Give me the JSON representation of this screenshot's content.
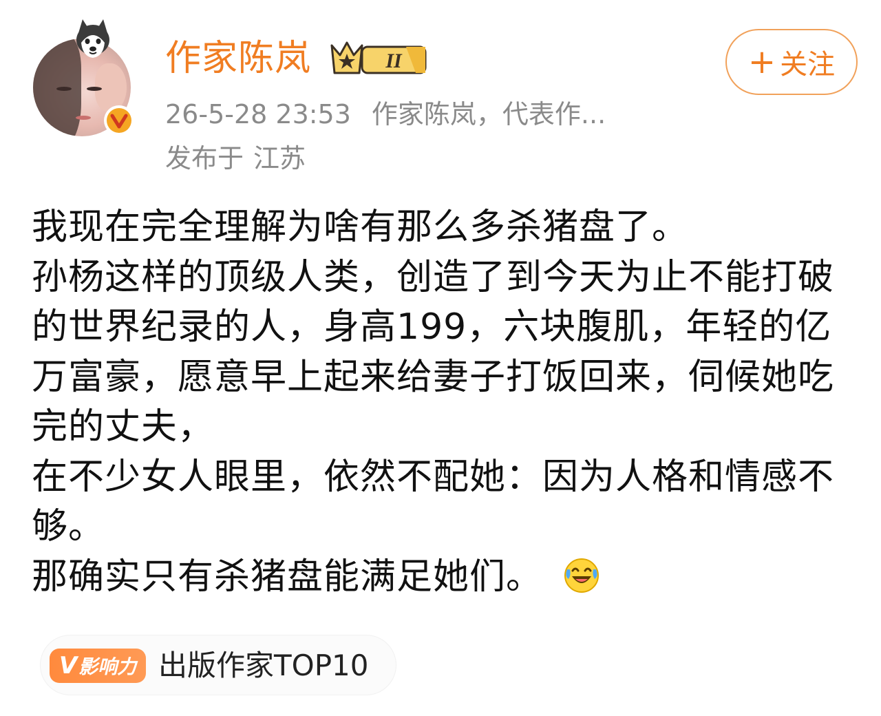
{
  "post": {
    "author": {
      "name": "作家陈岚",
      "level_badge": "II"
    },
    "follow_label": "关注",
    "follow_plus": "+",
    "timestamp": "26-5-28 23:53",
    "author_bio": "作家陈岚，代表作...",
    "location_prefix": "发布于",
    "location": "江苏",
    "paragraphs": [
      "我现在完全理解为啥有那么多杀猪盘了。",
      "孙杨这样的顶级人类，创造了到今天为止不能打破的世界纪录的人，身高199，六块腹肌，年轻的亿万富豪，愿意早上起来给妻子打饭回来，伺候她吃完的丈夫，",
      "在不少女人眼里，依然不配她：因为人格和情感不够。",
      "那确实只有杀猪盘能满足她们。"
    ],
    "influence": {
      "badge_v": "V",
      "badge_label": "影响力",
      "text": "出版作家TOP10"
    }
  },
  "colors": {
    "accent": "#f07d22",
    "meta_text": "#8a8a8a",
    "body_text": "#111111",
    "verified": "#f5a623"
  },
  "icons": {
    "avatar_ornament": "husky-icon",
    "verified": "verified-v-icon",
    "level": "crown-badge-icon",
    "emoji": "laughing-crying-emoji-icon"
  }
}
